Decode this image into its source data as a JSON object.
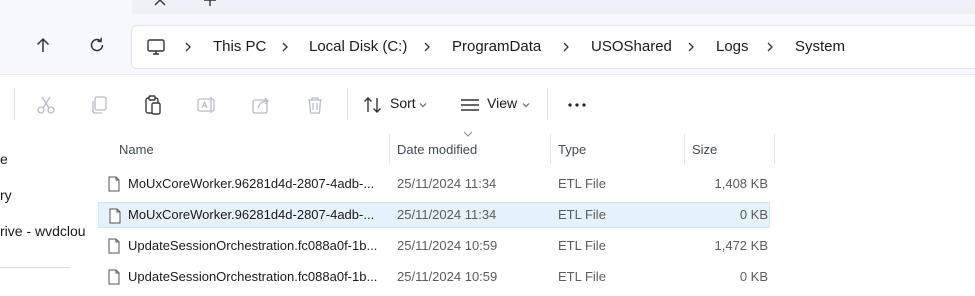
{
  "address": {
    "crumbs": [
      "This PC",
      "Local Disk (C:)",
      "ProgramData",
      "USOShared",
      "Logs",
      "System"
    ]
  },
  "toolbar": {
    "sort_label": "Sort",
    "view_label": "View"
  },
  "navpane": {
    "items": [
      "e",
      "ry",
      "rive - wvdclou"
    ]
  },
  "columns": {
    "name": "Name",
    "date": "Date modified",
    "type": "Type",
    "size": "Size"
  },
  "files": [
    {
      "name": "MoUxCoreWorker.96281d4d-2807-4adb-...",
      "date": "25/11/2024 11:34",
      "type": "ETL File",
      "size": "1,408 KB",
      "selected": false
    },
    {
      "name": "MoUxCoreWorker.96281d4d-2807-4adb-...",
      "date": "25/11/2024 11:34",
      "type": "ETL File",
      "size": "0 KB",
      "selected": true
    },
    {
      "name": "UpdateSessionOrchestration.fc088a0f-1b...",
      "date": "25/11/2024 10:59",
      "type": "ETL File",
      "size": "1,472 KB",
      "selected": false
    },
    {
      "name": "UpdateSessionOrchestration.fc088a0f-1b...",
      "date": "25/11/2024 10:59",
      "type": "ETL File",
      "size": "0 KB",
      "selected": false
    }
  ],
  "colors": {
    "selected_row": "#e5f1fb",
    "chrome_bg": "#f6f8fd"
  }
}
